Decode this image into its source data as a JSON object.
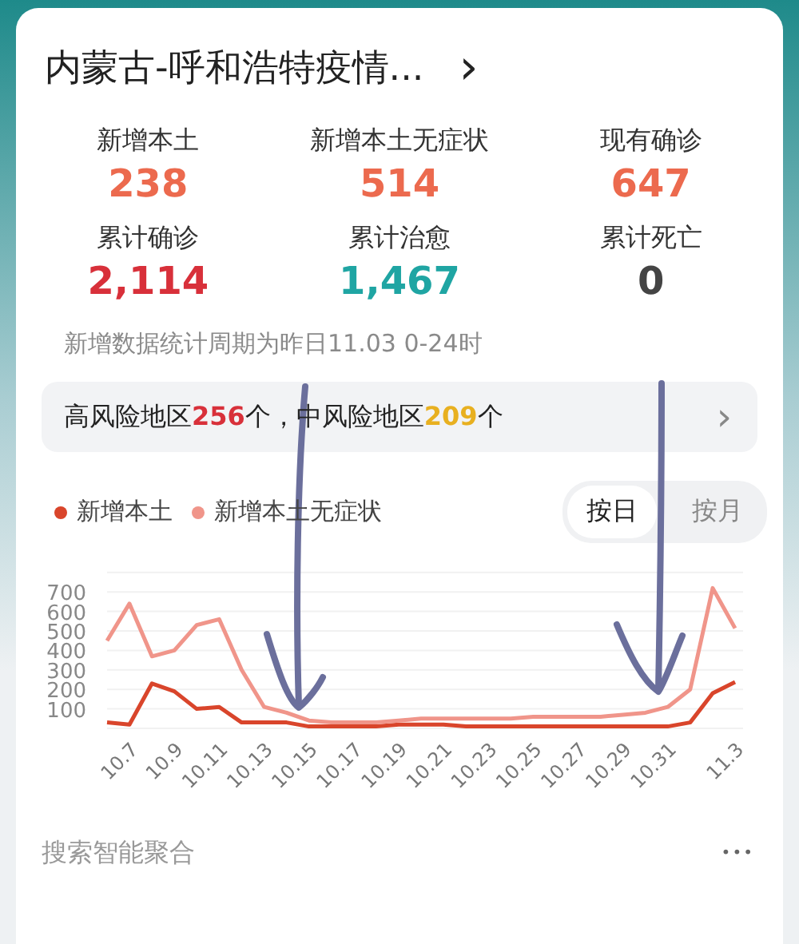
{
  "header": {
    "title": "内蒙古-呼和浩特疫情...",
    "chevron": "›"
  },
  "stats": [
    {
      "label": "新增本土",
      "value": "238",
      "kind": "orange"
    },
    {
      "label": "新增本土无症状",
      "value": "514",
      "kind": "orange"
    },
    {
      "label": "现有确诊",
      "value": "647",
      "kind": "orange"
    },
    {
      "label": "累计确诊",
      "value": "2,114",
      "kind": "red"
    },
    {
      "label": "累计治愈",
      "value": "1,467",
      "kind": "teal"
    },
    {
      "label": "累计死亡",
      "value": "0",
      "kind": "dark"
    }
  ],
  "note": "新增数据统计周期为昨日11.03 0-24时",
  "risk_bar": {
    "parts": [
      {
        "text": "高风险地区",
        "kind": "plain"
      },
      {
        "text": "256",
        "kind": "high"
      },
      {
        "text": "个，",
        "kind": "plain"
      },
      {
        "text": "中风险地区",
        "kind": "plain"
      },
      {
        "text": "209",
        "kind": "mid"
      },
      {
        "text": "个",
        "kind": "plain"
      }
    ],
    "chevron": "›"
  },
  "toggle": [
    {
      "label": "按日",
      "selected": true
    },
    {
      "label": "按月",
      "selected": false
    }
  ],
  "chart": {
    "chart_data": {
      "type": "line",
      "categories": [
        null,
        "10.7",
        null,
        "10.9",
        null,
        "10.11",
        null,
        "10.13",
        null,
        "10.15",
        null,
        "10.17",
        null,
        "10.19",
        null,
        "10.21",
        null,
        "10.23",
        null,
        "10.25",
        null,
        "10.27",
        null,
        "10.29",
        null,
        "10.31",
        null,
        null,
        "11.3"
      ],
      "yticks": [
        100,
        200,
        300,
        400,
        500,
        600,
        700
      ],
      "ylim": [
        0,
        800
      ],
      "grid": true,
      "series": [
        {
          "name": "新增本土",
          "color": "#d9452b",
          "values": [
            30,
            20,
            230,
            190,
            100,
            110,
            30,
            30,
            30,
            10,
            10,
            10,
            10,
            20,
            20,
            20,
            10,
            10,
            10,
            10,
            10,
            10,
            10,
            10,
            10,
            10,
            30,
            180,
            238
          ]
        },
        {
          "name": "新增本土无症状",
          "color": "#f0958a",
          "values": [
            450,
            640,
            370,
            400,
            530,
            560,
            300,
            110,
            80,
            40,
            30,
            30,
            30,
            40,
            50,
            50,
            50,
            50,
            50,
            60,
            60,
            60,
            60,
            70,
            80,
            110,
            200,
            720,
            514
          ]
        }
      ]
    }
  },
  "footer": {
    "text": "搜索智能聚合",
    "more": "•••"
  }
}
